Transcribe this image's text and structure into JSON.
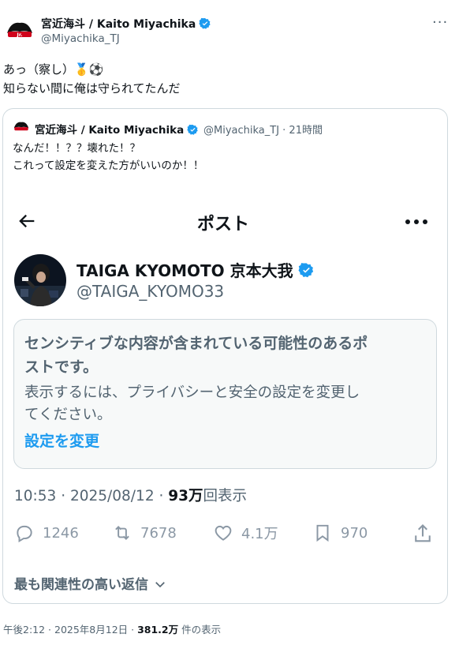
{
  "tweet": {
    "author_name": "宮近海斗 / Kaito Miyachika",
    "author_handle": "@Miyachika_TJ",
    "avatar_text": "Jr.",
    "line1": "あっ（察し）🥇⚽",
    "line2": "知らない間に俺は守られてたんだ",
    "more_label": "···"
  },
  "quote": {
    "author_name": "宮近海斗 / Kaito Miyachika",
    "meta": "@Miyachika_TJ · 21時間",
    "line1": "なんだ！！？？壊れた！？",
    "line2": "これって設定を変えた方がいいのか！！",
    "embedded": {
      "header_title": "ポスト",
      "user_name": "TAIGA KYOMOTO 京本大我",
      "user_handle": "@TAIGA_KYOMO33",
      "warning_title_1": "センシティブな内容が含まれている可能性のあるポ",
      "warning_title_2": "ストです。",
      "warning_sub_1": "表示するには、プライバシーと安全の設定を変更し",
      "warning_sub_2": "てください。",
      "warning_link": "設定を変更",
      "timestamp_prefix": "10:53 · 2025/08/12 · ",
      "views_count": "93万",
      "views_label": "回表示",
      "replies": "1246",
      "reposts": "7678",
      "likes": "4.1万",
      "bookmarks": "970",
      "relevant_replies": "最も関連性の高い返信"
    }
  },
  "footer": {
    "prefix": "午後2:12 · 2025年8月12日 · ",
    "views_count": "381.2万",
    "views_label": " 件の表示"
  },
  "colors": {
    "verified": "#1d9bf0",
    "link": "#1d9bf0",
    "muted": "#536471",
    "text": "#0f1419"
  }
}
